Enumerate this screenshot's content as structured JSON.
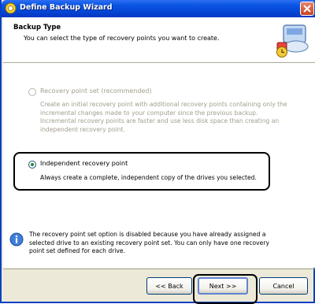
{
  "window": {
    "title": "Define Backup Wizard"
  },
  "header": {
    "title": "Backup Type",
    "subtitle": "You can select the type of recovery points you want to create."
  },
  "options": [
    {
      "label": "Recovery point set (recommended)",
      "description_lines": [
        "Create an initial recovery point with additional recovery points containing only the",
        "incremental changes made to your computer since the previous backup.",
        "Incremental recovery points are faster and use less disk space than creating an",
        "independent recovery point."
      ],
      "enabled": false,
      "selected": false
    },
    {
      "label": "Independent recovery point",
      "description_lines": [
        "Always create a complete, independent copy of the drives you selected."
      ],
      "enabled": true,
      "selected": true
    }
  ],
  "info": {
    "lines": [
      "The recovery point set option is disabled because you have already assigned a",
      "selected drive to an existing recovery point set. You can only have one recovery",
      "point set defined for each drive."
    ]
  },
  "buttons": {
    "back": "<< Back",
    "next": "Next >>",
    "cancel": "Cancel"
  }
}
